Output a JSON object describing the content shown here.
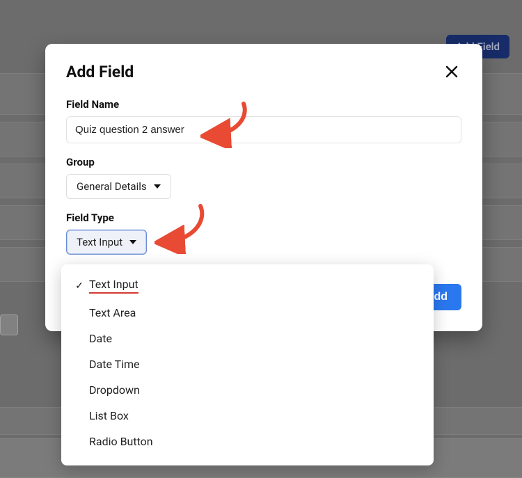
{
  "background": {
    "add_field_button": "Add Field"
  },
  "modal": {
    "title": "Add Field",
    "field_name_label": "Field Name",
    "field_name_value": "Quiz question 2 answer",
    "group_label": "Group",
    "group_selected": "General Details",
    "field_type_label": "Field Type",
    "field_type_selected": "Text Input",
    "add_button": "Add"
  },
  "field_type_menu": {
    "selected": "text-input",
    "options": [
      {
        "id": "text-input",
        "label": "Text Input"
      },
      {
        "id": "text-area",
        "label": "Text Area"
      },
      {
        "id": "date",
        "label": "Date"
      },
      {
        "id": "date-time",
        "label": "Date Time"
      },
      {
        "id": "dropdown",
        "label": "Dropdown"
      },
      {
        "id": "list-box",
        "label": "List Box"
      },
      {
        "id": "radio-button",
        "label": "Radio Button"
      }
    ]
  },
  "annotations": {
    "arrow1_target": "field-name-input",
    "arrow2_target": "field-type-select"
  }
}
